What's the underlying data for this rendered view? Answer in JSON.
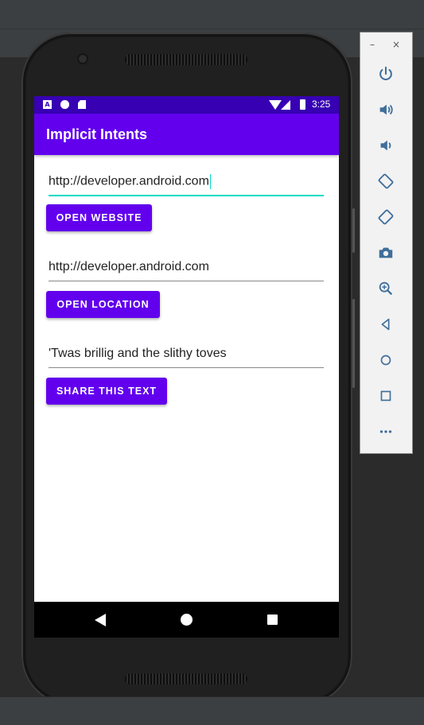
{
  "emulator_toolbar": {
    "minimize": "–",
    "close": "×",
    "buttons": [
      {
        "icon": "power-icon"
      },
      {
        "icon": "volume-up-icon"
      },
      {
        "icon": "volume-down-icon"
      },
      {
        "icon": "rotate-left-icon"
      },
      {
        "icon": "rotate-right-icon"
      },
      {
        "icon": "camera-icon"
      },
      {
        "icon": "zoom-icon"
      },
      {
        "icon": "back-icon"
      },
      {
        "icon": "home-icon"
      },
      {
        "icon": "overview-icon"
      },
      {
        "icon": "more-icon"
      }
    ]
  },
  "status_bar": {
    "time": "3:25",
    "left_icons": [
      "a-notification-icon",
      "circle-notification-icon",
      "sd-card-icon"
    ],
    "right_icons": [
      "wifi-icon",
      "cell-signal-icon",
      "battery-icon"
    ]
  },
  "app": {
    "title": "Implicit Intents",
    "website_field": {
      "value": "http://developer.android.com"
    },
    "open_website_button": "OPEN WEBSITE",
    "location_field": {
      "value": "http://developer.android.com"
    },
    "open_location_button": "OPEN LOCATION",
    "share_field": {
      "value": "'Twas brillig and the slithy toves"
    },
    "share_button": "SHARE THIS TEXT"
  },
  "colors": {
    "primary": "#6200ee",
    "primary_dark": "#3700b3",
    "accent": "#03dac5"
  }
}
